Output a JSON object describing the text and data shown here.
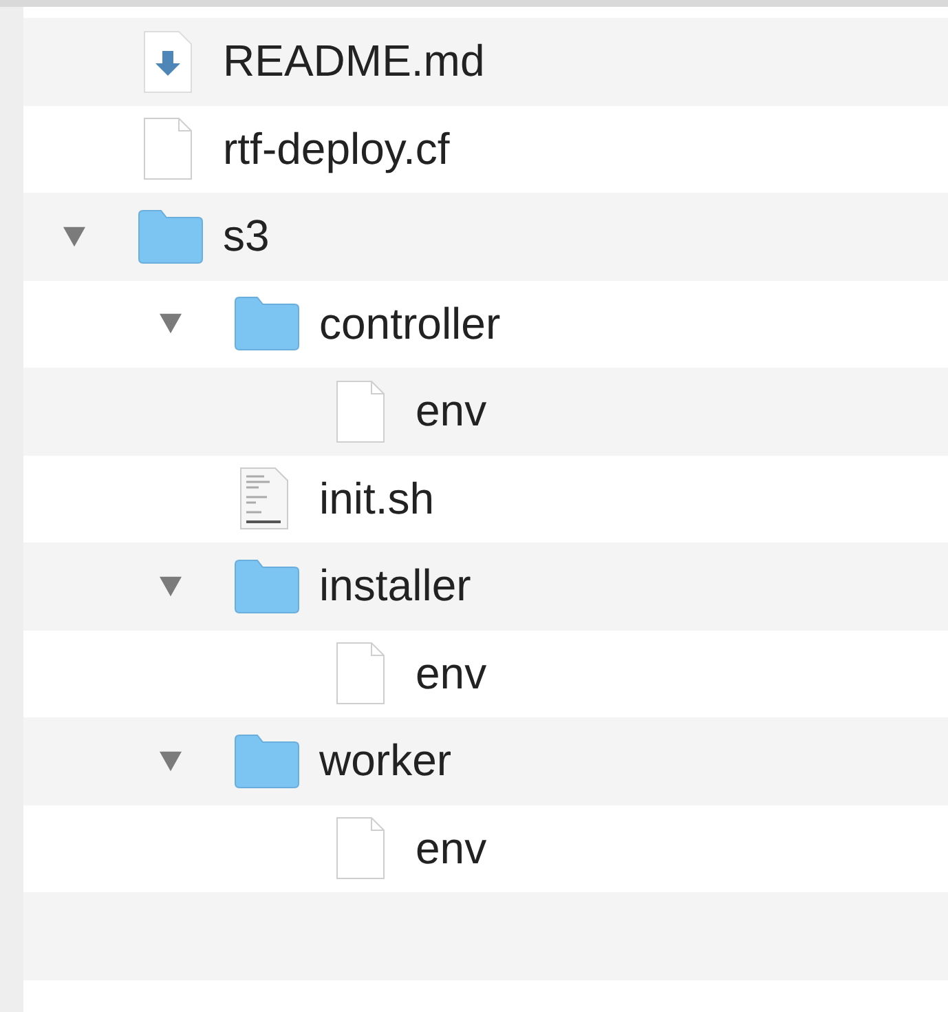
{
  "items": [
    {
      "name": "README.md",
      "kind": "markdown"
    },
    {
      "name": "rtf-deploy.cf",
      "kind": "file"
    },
    {
      "name": "s3",
      "kind": "folder",
      "expanded": true,
      "children": [
        {
          "name": "controller",
          "kind": "folder",
          "expanded": true,
          "children": [
            {
              "name": "env",
              "kind": "file"
            }
          ]
        },
        {
          "name": "init.sh",
          "kind": "script"
        },
        {
          "name": "installer",
          "kind": "folder",
          "expanded": true,
          "children": [
            {
              "name": "env",
              "kind": "file"
            }
          ]
        },
        {
          "name": "worker",
          "kind": "folder",
          "expanded": true,
          "children": [
            {
              "name": "env",
              "kind": "file"
            }
          ]
        }
      ]
    }
  ]
}
